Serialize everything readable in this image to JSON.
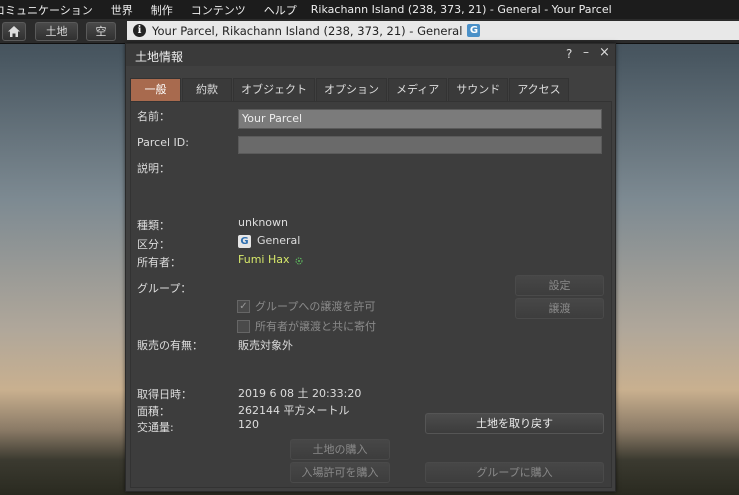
{
  "menubar": {
    "items": [
      "コミュニケーション",
      "世界",
      "制作",
      "コンテンツ",
      "ヘルプ"
    ],
    "location": "Rikachann Island (238, 373, 21) - General - Your Parcel"
  },
  "navbar": {
    "home_icon": "home-icon",
    "land_label": "土地",
    "sky_label": "空",
    "location_text": "Your Parcel, Rikachann Island (238, 373, 21) - General",
    "rating_badge": "G"
  },
  "floater": {
    "title": "土地情報",
    "help": "?",
    "minimize": "–",
    "close": "×",
    "tabs": [
      "一般",
      "約款",
      "オブジェクト",
      "オプション",
      "メディア",
      "サウンド",
      "アクセス"
    ],
    "active_tab": 0
  },
  "general": {
    "name_label": "名前：",
    "name_value": "Your Parcel",
    "parcel_id_label": "Parcel ID:",
    "parcel_id_value": "",
    "description_label": "説明：",
    "type_label": "種類：",
    "type_value": "unknown",
    "rating_label": "区分：",
    "rating_badge": "G",
    "rating_value": "General",
    "owner_label": "所有者：",
    "owner_value": "Fumi Hax",
    "group_label": "グループ：",
    "set_button": "設定",
    "deed_button": "譲渡",
    "allow_deed_label": "グループへの譲渡を許可",
    "allow_deed_checked": true,
    "owner_contrib_label": "所有者が譲渡と共に寄付",
    "owner_contrib_checked": false,
    "for_sale_label": "販売の有無：",
    "for_sale_value": "販売対象外",
    "acquired_label": "取得日時：",
    "acquired_value": "2019 6 08 土 20:33:20",
    "area_label": "面積：",
    "area_value": "262144 平方メートル",
    "traffic_label": "交通量:",
    "traffic_value": "120",
    "reclaim_button": "土地を取り戻す",
    "buy_land_button": "土地の購入",
    "buy_pass_button": "入場許可を購入",
    "buy_for_group_button": "グループに購入"
  }
}
